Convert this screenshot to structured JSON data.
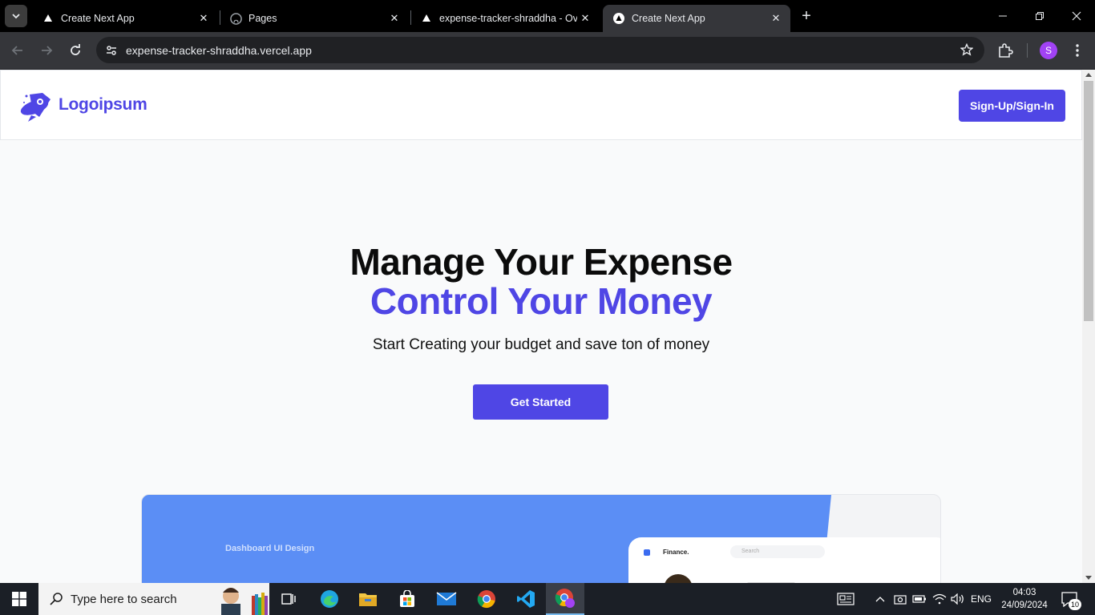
{
  "browser": {
    "tabs": [
      {
        "title": "Create Next App",
        "active": false
      },
      {
        "title": "Pages",
        "active": false
      },
      {
        "title": "expense-tracker-shraddha - Ove",
        "active": false
      },
      {
        "title": "Create Next App",
        "active": true
      }
    ],
    "url": "expense-tracker-shraddha.vercel.app",
    "profile_initial": "S",
    "profile_color": "#a142f4"
  },
  "site": {
    "logo_text": "Logoipsum",
    "signup_label": "Sign-Up/Sign-In",
    "accent": "#4f46e5",
    "hero": {
      "title_line1": "Manage Your Expense",
      "title_line2": "Control Your Money",
      "subtitle": "Start Creating your budget and save ton of money",
      "cta_label": "Get Started"
    },
    "preview": {
      "label": "Dashboard UI Design",
      "card_title": "Finance.",
      "search_placeholder": "Search"
    }
  },
  "taskbar": {
    "search_placeholder": "Type here to search",
    "language": "ENG",
    "time": "04:03",
    "date": "24/09/2024",
    "notification_count": "10"
  }
}
